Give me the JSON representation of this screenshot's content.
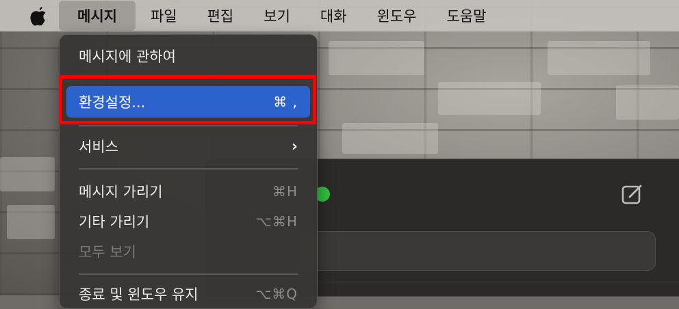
{
  "menubar": {
    "apple_icon": "apple-logo-icon",
    "menus": [
      {
        "label": "메시지",
        "active": true
      },
      {
        "label": "파일"
      },
      {
        "label": "편집"
      },
      {
        "label": "보기"
      },
      {
        "label": "대화"
      },
      {
        "label": "윈도우"
      },
      {
        "label": "도움말"
      }
    ]
  },
  "dropdown": {
    "items": [
      {
        "label": "메시지에 관하여",
        "shortcut": ""
      },
      {
        "label": "환경설정...",
        "shortcut": "⌘ ,",
        "highlighted": true
      },
      {
        "label": "서비스",
        "submenu_icon": "chevron-right-icon"
      },
      {
        "label": "메시지 가리기",
        "shortcut": "⌘H"
      },
      {
        "label": "기타 가리기",
        "shortcut": "⌥⌘H"
      },
      {
        "label": "모두 보기",
        "disabled": true
      },
      {
        "label": "종료 및 윈도우 유지",
        "shortcut": "⌥⌘Q"
      }
    ]
  },
  "window": {
    "compose_icon": "compose-icon"
  },
  "colors": {
    "highlight": "#2c62cc",
    "annotation": "#ff0000",
    "traffic_green": "#2fc23e"
  }
}
